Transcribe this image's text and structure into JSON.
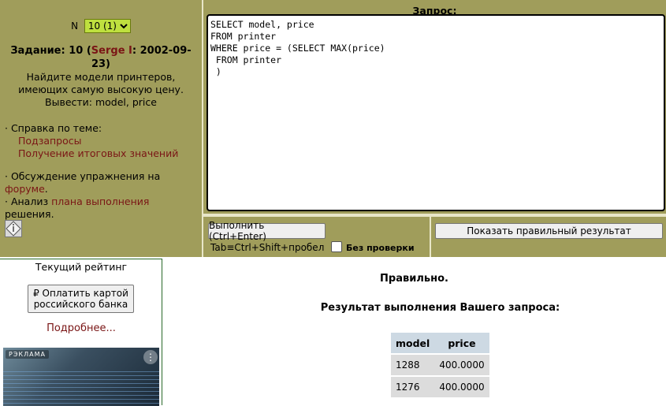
{
  "left": {
    "selector": {
      "label": "N",
      "value": "10 (1)"
    },
    "task": {
      "prefix": "Задание: 10 (",
      "author": "Serge I",
      "suffix": ": 2002-09-23)",
      "text": "Найдите модели принтеров, имеющих самую высокую цену. Вывести: model, price"
    },
    "help": {
      "title": "· Справка по теме:",
      "links": [
        "Подзапросы",
        "Получение итоговых значений"
      ]
    },
    "forum": {
      "text1": "· Обсуждение упражнения на",
      "link1": "форуме",
      "text2": "· Анализ",
      "link2": "плана выполнения",
      "text3": "решения."
    }
  },
  "query": {
    "title": "Запрос:",
    "text": "SELECT model, price\nFROM printer\nWHERE price = (SELECT MAX(price)\n FROM printer\n )"
  },
  "controls": {
    "execute_label": "Выполнить (Ctrl+Enter)",
    "show_result_label": "Показать правильный результат",
    "tab_hint": "Tab≡Ctrl+Shift+пробел",
    "no_check_label": "Без проверки"
  },
  "rating": {
    "title": "Текущий рейтинг",
    "pay_label_1": "₽ Оплатить картой",
    "pay_label_2": "российского банка",
    "more": "Подробнее...",
    "ad_label": "РЭКЛАМА"
  },
  "result": {
    "status": "Правильно.",
    "heading": "Результат выполнения Вашего запроса:",
    "columns": [
      "model",
      "price"
    ],
    "rows": [
      [
        "1288",
        "400.0000"
      ],
      [
        "1276",
        "400.0000"
      ]
    ]
  },
  "colors": {
    "panel": "#a09d5b",
    "link": "#7a1515",
    "select": "#bfe03f",
    "table_header": "#cdd9e3",
    "table_cell": "#dcdcdc"
  }
}
